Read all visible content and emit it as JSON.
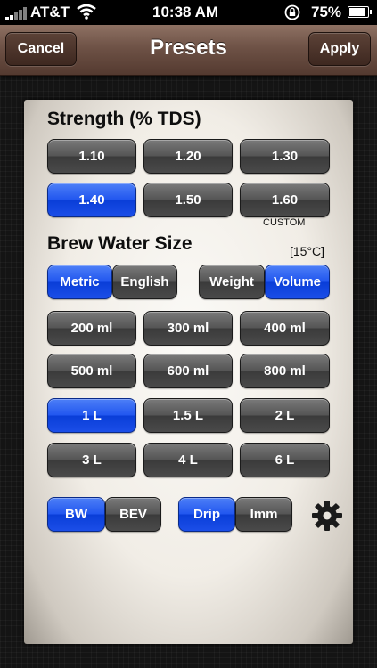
{
  "status_bar": {
    "carrier": "AT&T",
    "time": "10:38 AM",
    "battery": "75%",
    "icons": [
      "signal-bars-icon",
      "wifi-icon",
      "rotation-lock-icon",
      "battery-icon"
    ]
  },
  "nav": {
    "cancel_label": "Cancel",
    "title": "Presets",
    "apply_label": "Apply"
  },
  "strength": {
    "heading": "Strength (% TDS)",
    "options": [
      "1.10",
      "1.20",
      "1.30",
      "1.40",
      "1.50",
      "1.60"
    ],
    "selected": "1.40",
    "custom_label": "CUSTOM"
  },
  "brew_water": {
    "heading": "Brew Water Size",
    "temperature": "[15°C]",
    "unit_system": {
      "metric": "Metric",
      "english": "English",
      "selected": "Metric"
    },
    "measure_type": {
      "weight": "Weight",
      "volume": "Volume",
      "selected": "Volume"
    },
    "sizes": [
      "200 ml",
      "300 ml",
      "400 ml",
      "500 ml",
      "600 ml",
      "800 ml",
      "1 L",
      "1.5 L",
      "2 L",
      "3 L",
      "4 L",
      "6 L"
    ],
    "selected": "1 L"
  },
  "footer": {
    "bw_label": "BW",
    "bev_label": "BEV",
    "bw_selected": "BW",
    "drip_label": "Drip",
    "imm_label": "Imm",
    "method_selected": "Drip",
    "settings_icon": "gear-icon"
  },
  "colors": {
    "accent_blue": "#2257ef",
    "button_gray": "#4a4a4a",
    "navbar_brown": "#6e5246"
  }
}
